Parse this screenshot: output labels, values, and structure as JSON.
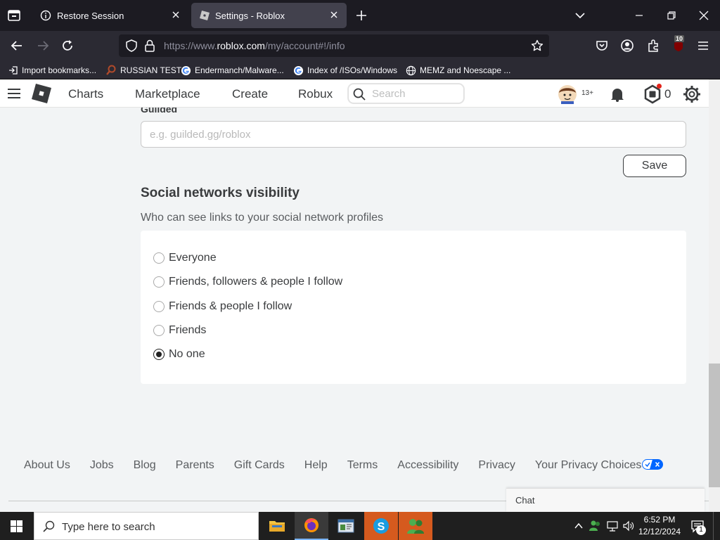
{
  "browser": {
    "tabs": [
      {
        "label": "Restore Session",
        "icon": "info-icon",
        "active": false
      },
      {
        "label": "Settings - Roblox",
        "icon": "roblox-icon",
        "active": true
      }
    ],
    "url_prefix": "https://www.",
    "url_domain": "roblox.com",
    "url_path": "/my/account#!/info",
    "extension_badge": "10",
    "bookmarks": [
      {
        "label": "Import bookmarks...",
        "icon": "import-icon"
      },
      {
        "label": "RUSSIAN TEST",
        "icon": "magnifier-icon"
      },
      {
        "label": "Endermanch/Malware...",
        "icon": "google-icon"
      },
      {
        "label": "Index of /ISOs/Windows",
        "icon": "google-icon"
      },
      {
        "label": "MEMZ and Noescape ...",
        "icon": "globe-icon"
      }
    ]
  },
  "header": {
    "nav": [
      "Charts",
      "Marketplace",
      "Create",
      "Robux"
    ],
    "search_placeholder": "Search",
    "age_badge": "13+",
    "robux_count": "0"
  },
  "settings": {
    "guilded_label": "Guilded",
    "guilded_placeholder": "e.g. guilded.gg/roblox",
    "save_label": "Save",
    "social_title": "Social networks visibility",
    "social_desc": "Who can see links to your social network profiles",
    "visibility_options": [
      {
        "label": "Everyone",
        "selected": false
      },
      {
        "label": "Friends, followers & people I follow",
        "selected": false
      },
      {
        "label": "Friends & people I follow",
        "selected": false
      },
      {
        "label": "Friends",
        "selected": false
      },
      {
        "label": "No one",
        "selected": true
      }
    ]
  },
  "footer": {
    "links": [
      "About Us",
      "Jobs",
      "Blog",
      "Parents",
      "Gift Cards",
      "Help",
      "Terms",
      "Accessibility",
      "Privacy",
      "Your Privacy Choices"
    ]
  },
  "chat": {
    "label": "Chat"
  },
  "taskbar": {
    "search_placeholder": "Type here to search",
    "time": "6:52 PM",
    "date": "12/12/2024",
    "notification_count": "1"
  },
  "colors": {
    "chrome_dark": "#1c1b22",
    "chrome_mid": "#2b2a33",
    "roblox_bg": "#f2f4f5",
    "text": "#393b3d",
    "notification_dot": "#e2231a"
  }
}
